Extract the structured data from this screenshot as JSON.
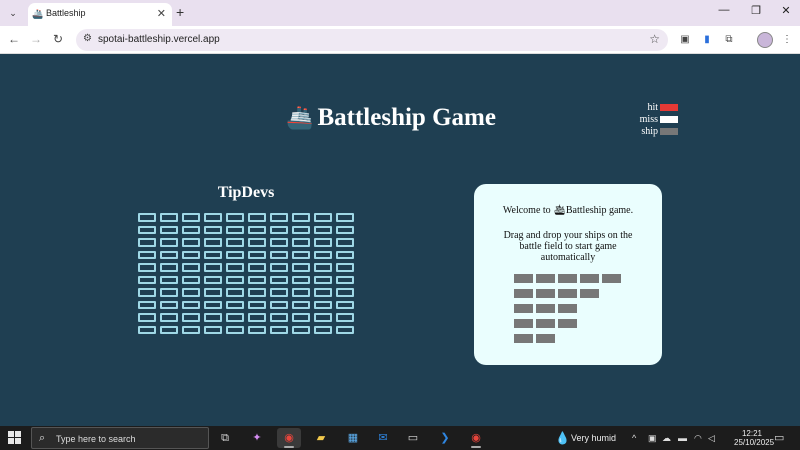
{
  "browser": {
    "tab_menu_icon": "chevron-down-icon",
    "tab_favicon": "🚢",
    "tab_title": "Battleship",
    "tab_close": "✕",
    "new_tab": "+",
    "minimize": "—",
    "restore": "❐",
    "close": "✕",
    "back": "←",
    "forward": "→",
    "reload": "↻",
    "site_info_icon": "⚙",
    "url": "spotai-battleship.vercel.app",
    "bookmark_star": "☆"
  },
  "page": {
    "title_icon": "🚢",
    "title": "Battleship Game",
    "legend": [
      {
        "label": "hit",
        "color": "#e53935"
      },
      {
        "label": "miss",
        "color": "#ffffff"
      },
      {
        "label": "ship",
        "color": "#777777"
      }
    ],
    "player_name": "TipDevs",
    "grid": {
      "rows": 10,
      "cols": 10,
      "cell_color": "#9fd8e6"
    },
    "welcome_prefix": "Welcome to ",
    "welcome_icon": "🛳",
    "welcome_suffix": "Battleship game.",
    "instructions": "Drag and drop your ships on the battle field to start game automatically",
    "ships": [
      5,
      4,
      3,
      3,
      2
    ],
    "ship_color": "#777777"
  },
  "taskbar": {
    "search_placeholder": "Type here to search",
    "weather": "Very humid",
    "time": "12:21",
    "date": "25/10/2025"
  }
}
